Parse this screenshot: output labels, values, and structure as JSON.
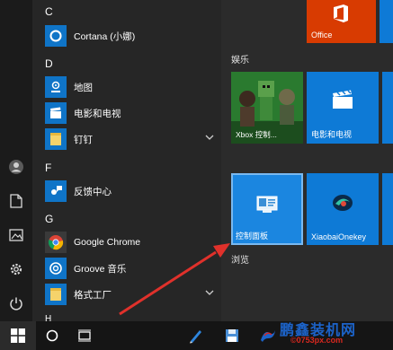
{
  "letters": {
    "c": "C",
    "d": "D",
    "f": "F",
    "g": "G",
    "h": "H"
  },
  "apps": {
    "cortana": "Cortana (小娜)",
    "maps": "地图",
    "movies": "电影和电视",
    "dingding": "钉钉",
    "feedback": "反馈中心",
    "chrome": "Google Chrome",
    "groove": "Groove 音乐",
    "format_factory": "格式工厂"
  },
  "groups": {
    "entertainment": "娱乐",
    "browse": "浏览"
  },
  "tiles": {
    "office": "Office",
    "xbox": "Xbox 控制...",
    "movies": "电影和电视",
    "control_panel": "控制面板",
    "xiaobai": "XiaobaiOnekey"
  },
  "watermark": {
    "title": "鹏鑫装机网",
    "url": "©0753px.com"
  },
  "colors": {
    "tile_blue": "#0e7ad6",
    "office_red": "#d83b01",
    "arrow_red": "#e0312b"
  }
}
